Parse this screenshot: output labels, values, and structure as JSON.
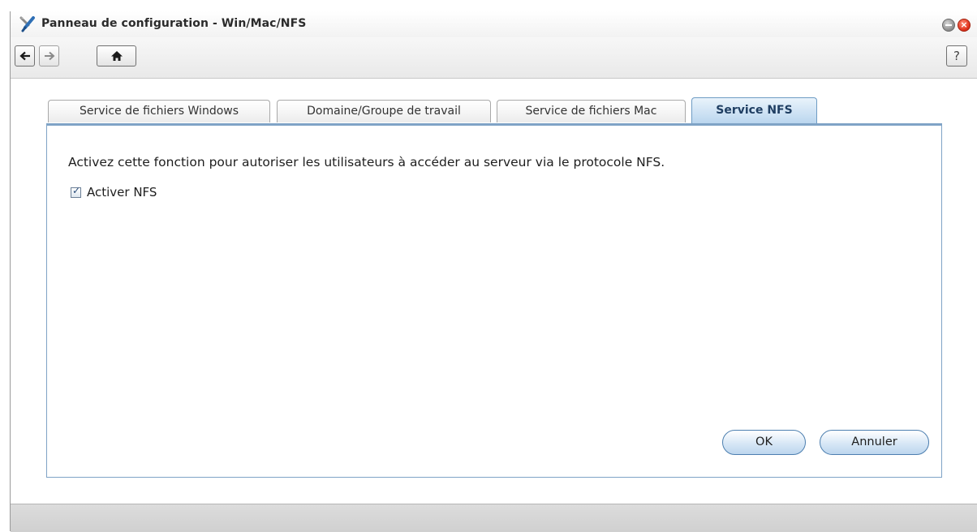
{
  "window": {
    "title": "Panneau de configuration - Win/Mac/NFS",
    "app_icon": "control-panel-tools-icon"
  },
  "toolbar": {
    "back_icon": "arrow-left-icon",
    "forward_icon": "arrow-right-icon",
    "home_icon": "home-icon",
    "help_label": "?"
  },
  "tabs": [
    {
      "label": "Service de fichiers Windows",
      "active": false
    },
    {
      "label": "Domaine/Groupe de travail",
      "active": false
    },
    {
      "label": "Service de fichiers Mac",
      "active": false
    },
    {
      "label": "Service NFS",
      "active": true
    }
  ],
  "nfs": {
    "description": "Activez cette fonction pour autoriser les utilisateurs à accéder au serveur via le protocole NFS.",
    "enable_label": "Activer NFS",
    "enable_checked": true
  },
  "buttons": {
    "ok_label": "OK",
    "cancel_label": "Annuler"
  },
  "colors": {
    "active_tab_border": "#6e9cc4",
    "panel_border": "#7fa3c6",
    "close_button": "#e0321c"
  }
}
